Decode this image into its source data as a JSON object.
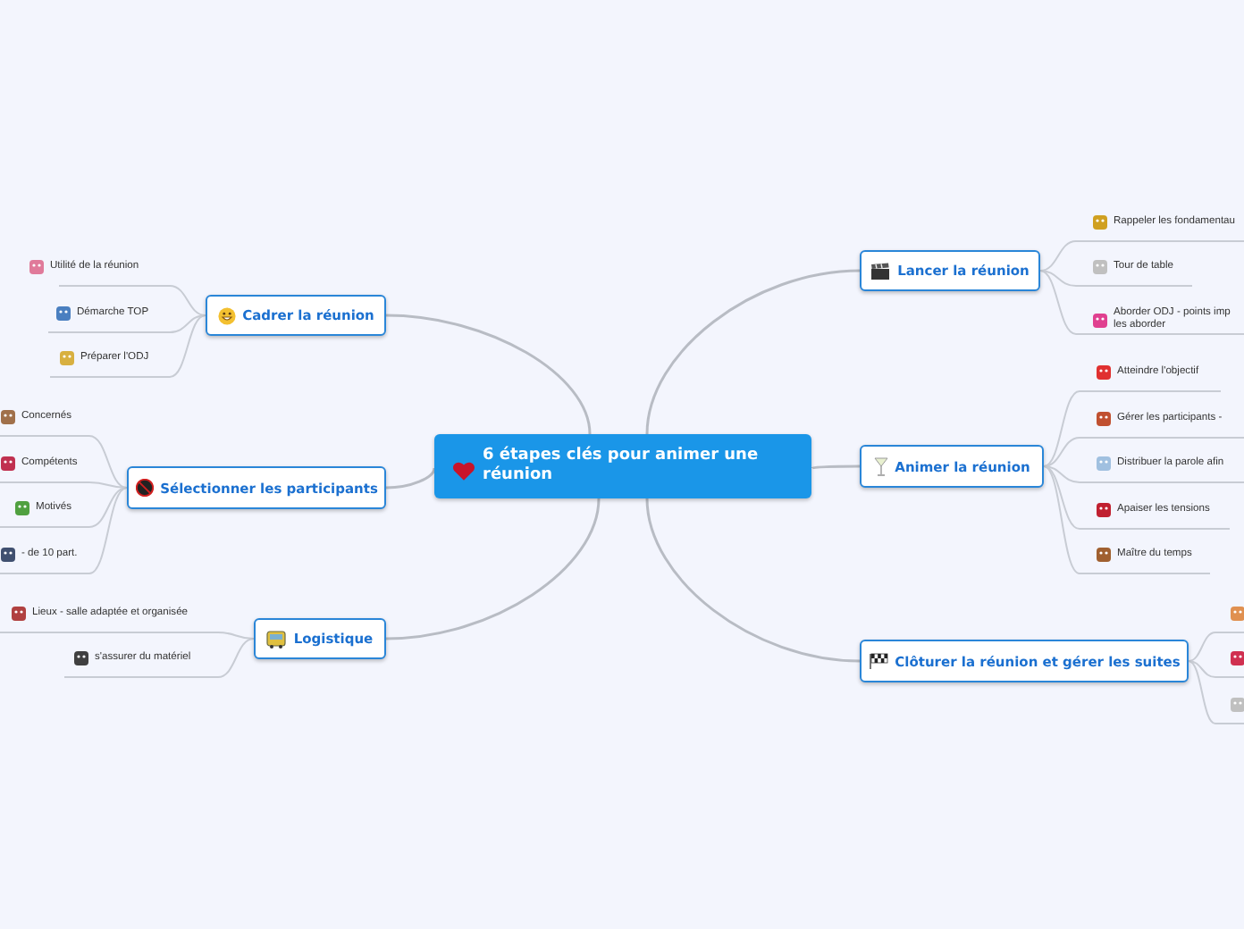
{
  "central_topic": {
    "title": "6 étapes clés pour animer une réunion"
  },
  "branches": [
    {
      "title": "Cadrer la réunion",
      "leaves": [
        {
          "text": "Utilité de la réunion"
        },
        {
          "text": "Démarche TOP"
        },
        {
          "text": "Préparer l'ODJ"
        }
      ]
    },
    {
      "title": "Sélectionner les participants",
      "leaves": [
        {
          "text": "Concernés"
        },
        {
          "text": "Compétents"
        },
        {
          "text": "Motivés"
        },
        {
          "text": "- de 10 part."
        }
      ]
    },
    {
      "title": "Logistique",
      "leaves": [
        {
          "text": "Lieux - salle adaptée et organisée"
        },
        {
          "text": "s'assurer du matériel"
        }
      ]
    },
    {
      "title": "Lancer la réunion",
      "leaves": [
        {
          "text": "Rappeler les fondamentau"
        },
        {
          "text": "Tour de table"
        },
        {
          "text": "Aborder ODJ - points imp les aborder"
        }
      ]
    },
    {
      "title": "Animer la réunion",
      "leaves": [
        {
          "text": "Atteindre l'objectif"
        },
        {
          "text": "Gérer les participants -"
        },
        {
          "text": "Distribuer la parole afin"
        },
        {
          "text": "Apaiser les tensions"
        },
        {
          "text": "Maître du temps"
        }
      ]
    },
    {
      "title": "Clôturer la réunion et gérer les suites"
    }
  ]
}
